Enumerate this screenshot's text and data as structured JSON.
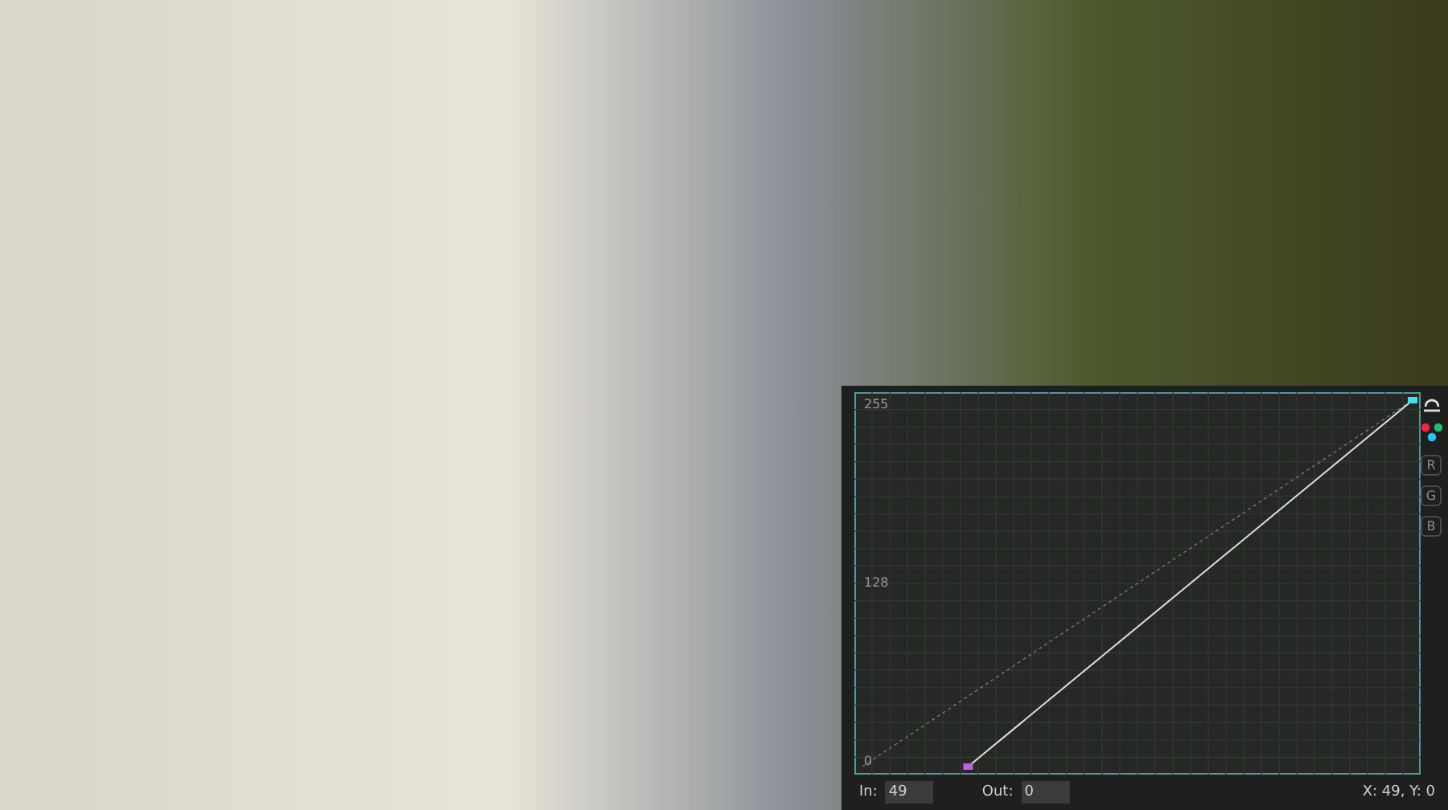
{
  "curves_panel": {
    "axis_labels": [
      "255",
      "128",
      "0"
    ],
    "channels": [
      {
        "kind": "rgb",
        "selected": true
      },
      {
        "kind": "letter",
        "label": "R",
        "selected": false
      },
      {
        "kind": "letter",
        "label": "G",
        "selected": false
      },
      {
        "kind": "letter",
        "label": "B",
        "selected": false
      }
    ],
    "in_label": "In:",
    "in_value": "49",
    "out_label": "Out:",
    "out_value": "0",
    "coordinates": "X: 49, Y: 0"
  }
}
